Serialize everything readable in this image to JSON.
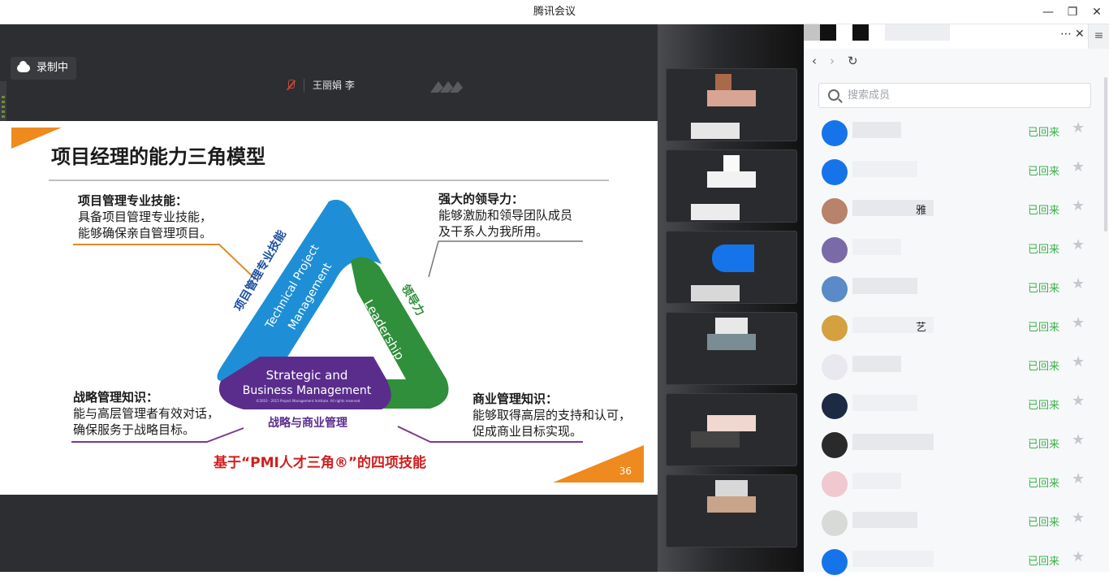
{
  "window": {
    "title": "腾讯会议",
    "controls": [
      "minimize",
      "restore",
      "close"
    ]
  },
  "stage": {
    "recording_label": "录制中",
    "speaker_name": "王丽娟 李"
  },
  "slide": {
    "heading": "项目经理的能力三角模型",
    "blocks": {
      "technical": {
        "title": "项目管理专业技能：",
        "lines": [
          "具备项目管理专业技能，",
          "能够确保亲自管理项目。"
        ]
      },
      "leadership": {
        "title": "强大的领导力：",
        "lines": [
          "能够激励和领导团队成员",
          "及干系人为我所用。"
        ]
      },
      "strategic": {
        "title": "战略管理知识：",
        "lines": [
          "能与高层管理者有效对话，",
          "确保服务于战略目标。"
        ]
      },
      "business": {
        "title": "商业管理知识：",
        "lines": [
          "能够取得高层的支持和认可，",
          "促成商业目标实现。"
        ]
      }
    },
    "triangle": {
      "left_en_1": "Technical Project",
      "left_en_2": "Management",
      "left_cn": "项目管理专业技能",
      "right_en": "Leadership",
      "right_cn": "领导力",
      "bottom_en_1": "Strategic and",
      "bottom_en_2": "Business Management",
      "bottom_copyright": "©2010 - 2015 Project Management Institute. All rights reserved.",
      "bottom_cn": "战略与商业管理",
      "colors": {
        "blue": "#1e8fd6",
        "green": "#2f8f3a",
        "purple": "#5a2d8c"
      }
    },
    "tagline": "基于“PMI人才三角®”的四项技能",
    "page_number": "36",
    "accent": "#ef8a1e"
  },
  "panel": {
    "search_placeholder": "搜索成员",
    "members": [
      {
        "name": "",
        "status": "已回来"
      },
      {
        "name": "",
        "status": "已回来"
      },
      {
        "name": "雅",
        "status": "已回来"
      },
      {
        "name": "",
        "status": "已回来"
      },
      {
        "name": "",
        "status": "已回来"
      },
      {
        "name": "艺",
        "status": "已回来"
      },
      {
        "name": "",
        "status": "已回来"
      },
      {
        "name": "",
        "status": "已回来"
      },
      {
        "name": "",
        "status": "已回来"
      },
      {
        "name": "",
        "status": "已回来"
      },
      {
        "name": "",
        "status": "已回来"
      },
      {
        "name": "",
        "status": "已回来"
      }
    ],
    "status_color": "#3cb24a"
  }
}
